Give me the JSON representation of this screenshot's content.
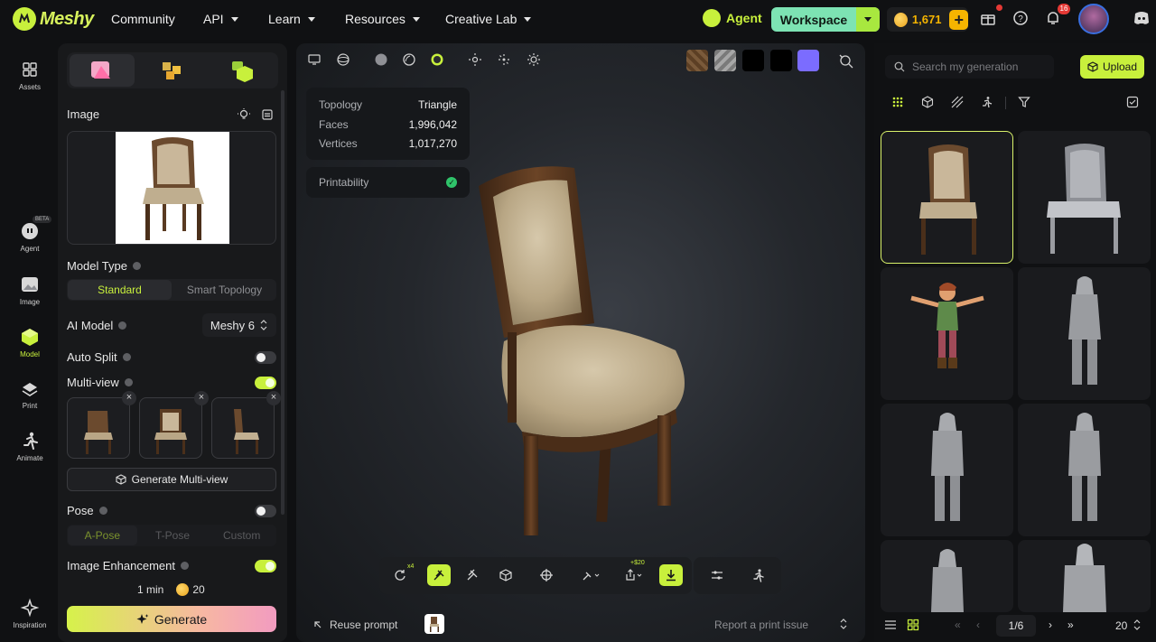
{
  "brand": {
    "name": "Meshy",
    "accent": "#c8f03c"
  },
  "nav": {
    "items": [
      {
        "label": "Community",
        "caret": false
      },
      {
        "label": "API",
        "caret": true
      },
      {
        "label": "Learn",
        "caret": true
      },
      {
        "label": "Resources",
        "caret": true
      },
      {
        "label": "Creative Lab",
        "caret": true
      }
    ],
    "agent_label": "Agent",
    "workspace_label": "Workspace",
    "credits": "1,671",
    "notification_count": "16"
  },
  "rail": {
    "items": [
      {
        "label": "Assets",
        "icon": "grid-icon"
      },
      {
        "label": "Agent",
        "icon": "agent-icon",
        "badge": "BETA"
      },
      {
        "label": "Image",
        "icon": "image-icon"
      },
      {
        "label": "Model",
        "icon": "cube-icon"
      },
      {
        "label": "Print",
        "icon": "printer-icon"
      },
      {
        "label": "Animate",
        "icon": "running-icon"
      },
      {
        "label": "Inspiration",
        "icon": "sparkle-icon"
      }
    ]
  },
  "panel": {
    "image_label": "Image",
    "model_type_label": "Model Type",
    "model_types": [
      "Standard",
      "Smart Topology"
    ],
    "model_type_selected": "Standard",
    "ai_model_label": "AI Model",
    "ai_model_value": "Meshy 6",
    "auto_split_label": "Auto Split",
    "auto_split_on": false,
    "multiview_label": "Multi-view",
    "multiview_on": true,
    "generate_multiview_label": "Generate Multi-view",
    "pose_label": "Pose",
    "pose_on": false,
    "poses": [
      "A-Pose",
      "T-Pose",
      "Custom"
    ],
    "image_enhancement_label": "Image Enhancement",
    "image_enhancement_on": true,
    "eta": "1 min",
    "cost": "20",
    "generate_label": "Generate"
  },
  "viewport": {
    "stats": [
      {
        "label": "Topology",
        "value": "Triangle"
      },
      {
        "label": "Faces",
        "value": "1,996,042"
      },
      {
        "label": "Vertices",
        "value": "1,017,270"
      }
    ],
    "printability_label": "Printability",
    "remesh_count": "x4",
    "export_cost": "+$20",
    "reuse_prompt_label": "Reuse prompt",
    "report_label": "Report a print issue",
    "swatch_colors": [
      "#7a5a3a",
      "#9a9a9a",
      "#000000",
      "#000000",
      "#7b6cff"
    ]
  },
  "gallery": {
    "search_placeholder": "Search my generation",
    "upload_label": "Upload",
    "page": "1/6",
    "page_size": "20"
  }
}
